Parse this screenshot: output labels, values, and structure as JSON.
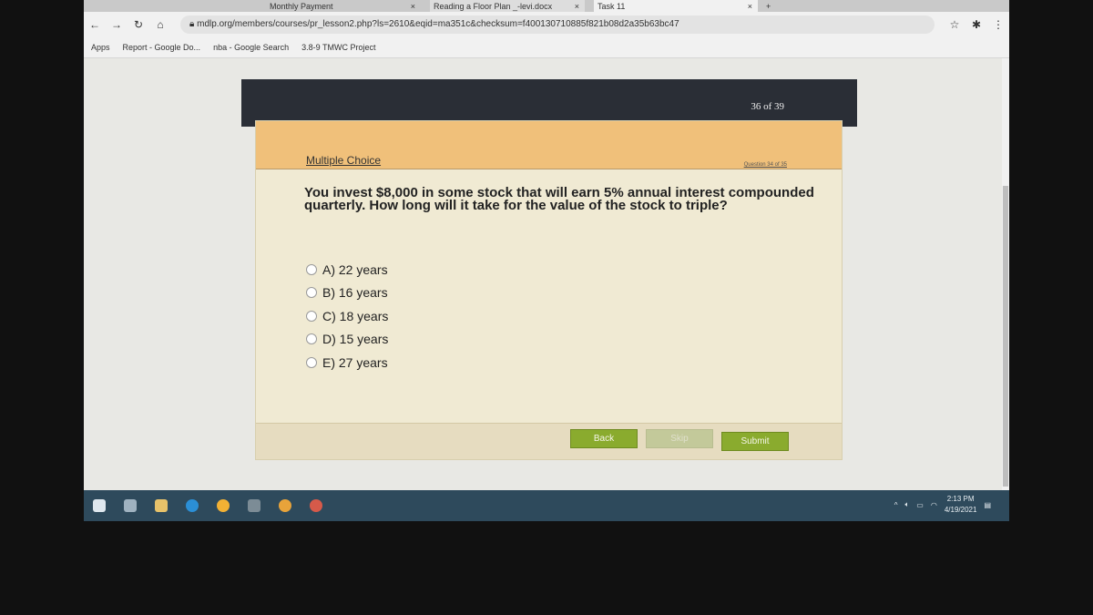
{
  "browser": {
    "tabs": [
      {
        "label": "Monthly Payment"
      },
      {
        "label": "Reading a Floor Plan _-levi.docx"
      },
      {
        "label": "Task 11"
      }
    ],
    "new_tab": "+",
    "url": "mdlp.org/members/courses/pr_lesson2.php?ls=2610&eqid=ma351c&checksum=f400130710885f821b08d2a35b63bc47",
    "bookmarks": [
      {
        "label": "Apps"
      },
      {
        "label": "Report - Google Do..."
      },
      {
        "label": "nba - Google Search"
      },
      {
        "label": "3.8-9 TMWC Project"
      }
    ]
  },
  "quiz": {
    "progress": "36 of 39",
    "type_label": "Multiple Choice",
    "question_number": "Question 34 of 35",
    "question": "You invest $8,000 in some stock that will earn 5% annual interest compounded quarterly.  How long will it take for the value of the stock to triple?",
    "options": [
      {
        "label": "A) 22 years"
      },
      {
        "label": "B) 16 years"
      },
      {
        "label": "C) 18 years"
      },
      {
        "label": "D) 15 years"
      },
      {
        "label": "E) 27 years"
      }
    ],
    "buttons": {
      "back": "Back",
      "skip": "Skip",
      "submit": "Submit"
    },
    "colors": {
      "header": "#f0c07a",
      "button": "#8aab2e"
    }
  },
  "taskbar": {
    "time": "2:13 PM",
    "date": "4/19/2021"
  }
}
